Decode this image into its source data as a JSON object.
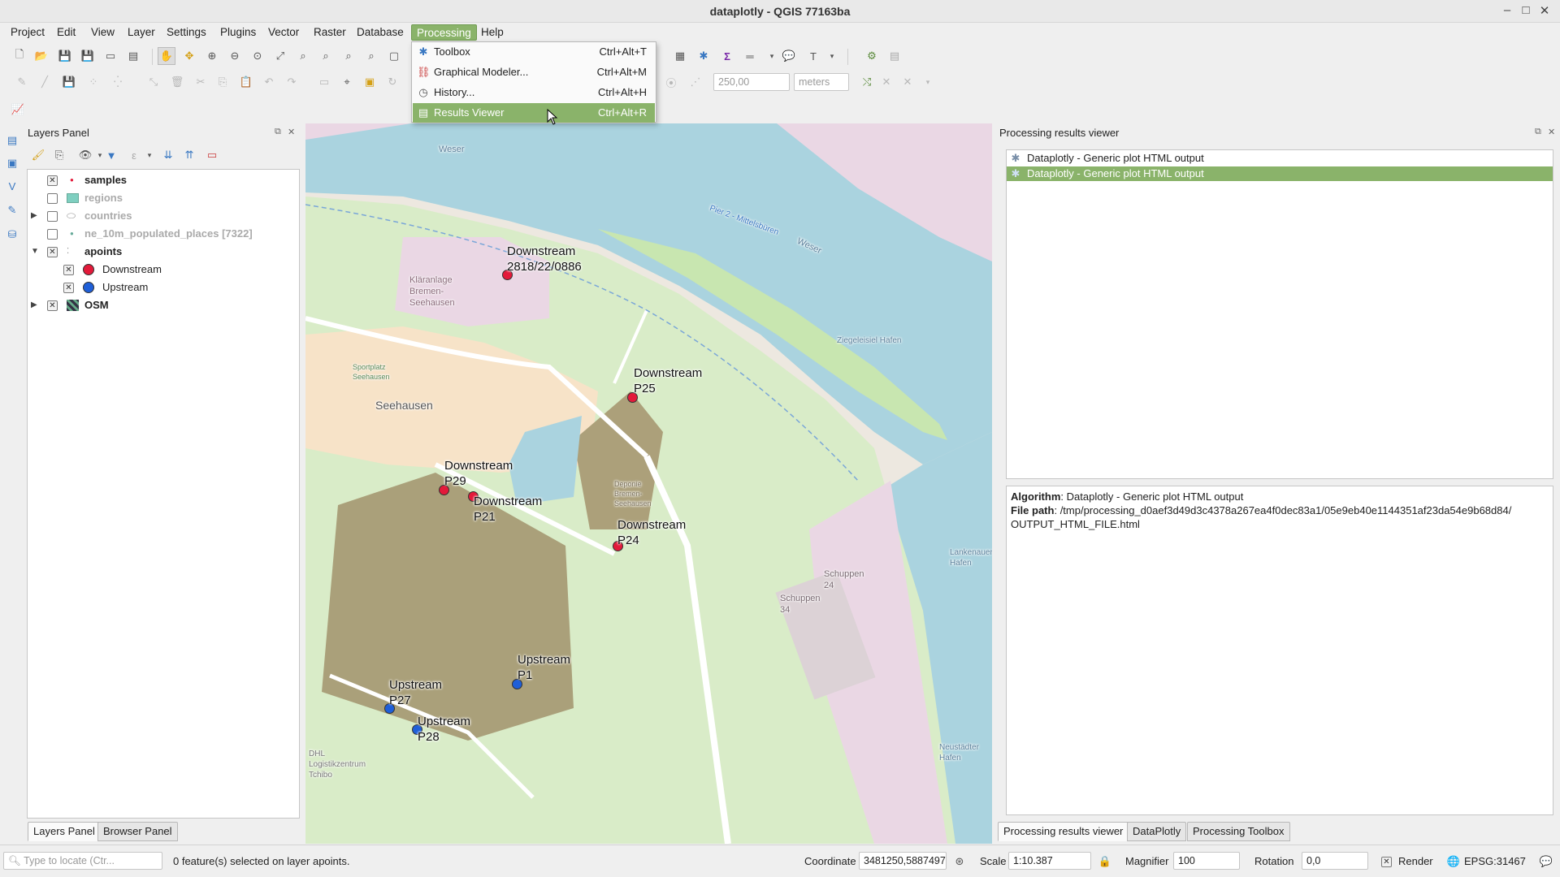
{
  "window": {
    "title": "dataplotly - QGIS 77163ba",
    "controls": [
      "–",
      "□",
      "✕"
    ]
  },
  "menubar": [
    "Project",
    "Edit",
    "View",
    "Layer",
    "Settings",
    "Plugins",
    "Vector",
    "Raster",
    "Database",
    "Processing",
    "Help"
  ],
  "processing_menu": {
    "items": [
      {
        "label": "Toolbox",
        "shortcut": "Ctrl+Alt+T",
        "icon": "gear-icon"
      },
      {
        "label": "Graphical Modeler...",
        "shortcut": "Ctrl+Alt+M",
        "icon": "modeler-icon"
      },
      {
        "label": "History...",
        "shortcut": "Ctrl+Alt+H",
        "icon": "history-icon"
      },
      {
        "label": "Results Viewer",
        "shortcut": "Ctrl+Alt+R",
        "icon": "results-icon"
      }
    ]
  },
  "toolbar": {
    "scale_field": "250,00",
    "units_select": "meters"
  },
  "layers_panel": {
    "title": "Layers Panel",
    "layers": [
      {
        "name": "samples",
        "checked": true,
        "bold": true
      },
      {
        "name": "regions",
        "checked": false,
        "bold": false
      },
      {
        "name": "countries",
        "checked": false,
        "bold": false
      },
      {
        "name": "ne_10m_populated_places [7322]",
        "checked": false,
        "bold": false
      },
      {
        "name": "apoints",
        "checked": true,
        "bold": true
      },
      {
        "name": "Downstream",
        "checked": true,
        "bold": false
      },
      {
        "name": "Upstream",
        "checked": true,
        "bold": false
      },
      {
        "name": "OSM",
        "checked": true,
        "bold": true
      }
    ],
    "tabs": [
      "Layers Panel",
      "Browser Panel"
    ]
  },
  "map": {
    "place_labels": [
      "Weser",
      "Pier 2 - Mittelsbüren",
      "Weser",
      "Kläranlage Bremen-Seehausen",
      "Sportplatz Seehausen",
      "Seehausen",
      "Ziegeleisiel Hafen",
      "Deponie Bremen-Seehausen",
      "Schuppen 24",
      "Schuppen 34",
      "Lankenauer Hafen",
      "Neustädter Hafen",
      "DHL Logistikzentrum Tchibo"
    ],
    "points": [
      {
        "type": "Downstream",
        "label1": "Downstream",
        "label2": "2818/22/0886"
      },
      {
        "type": "Downstream",
        "label1": "Downstream",
        "label2": "P25"
      },
      {
        "type": "Downstream",
        "label1": "Downstream",
        "label2": "P29"
      },
      {
        "type": "Downstream",
        "label1": "Downstream",
        "label2": "P21"
      },
      {
        "type": "Downstream",
        "label1": "Downstream",
        "label2": "P24"
      },
      {
        "type": "Upstream",
        "label1": "Upstream",
        "label2": "P1"
      },
      {
        "type": "Upstream",
        "label1": "Upstream",
        "label2": "P27"
      },
      {
        "type": "Upstream",
        "label1": "Upstream",
        "label2": "P28"
      }
    ],
    "colors": {
      "downstream": "#e31a3a",
      "upstream": "#1f5fd8",
      "water": "#aad3df",
      "green": "#c8e6b0"
    }
  },
  "results_viewer": {
    "title": "Processing results viewer",
    "items": [
      {
        "label": "Dataplotly - Generic plot HTML output",
        "selected": false
      },
      {
        "label": "Dataplotly - Generic plot HTML output",
        "selected": true
      }
    ],
    "detail": {
      "algorithm_key": "Algorithm",
      "algorithm_val": "Dataplotly - Generic plot HTML output",
      "path_key": "File path",
      "path_val": "/tmp/processing_d0aef3d49d3c4378a267ea4f0dec83a1/05e9eb40e1144351af23da54e9b68d84/",
      "path_val2": "OUTPUT_HTML_FILE.html"
    },
    "tabs": [
      "Processing results viewer",
      "DataPlotly",
      "Processing Toolbox"
    ]
  },
  "statusbar": {
    "locate_placeholder": "Type to locate (Ctr...",
    "message": "0 feature(s) selected on layer apoints.",
    "coordinate_label": "Coordinate",
    "coordinate_value": "3481250,5887497",
    "scale_label": "Scale",
    "scale_value": "1:10.387",
    "magnifier_label": "Magnifier",
    "magnifier_value": "100",
    "rotation_label": "Rotation",
    "rotation_value": "0,0",
    "render_label": "Render",
    "crs": "EPSG:31467"
  }
}
